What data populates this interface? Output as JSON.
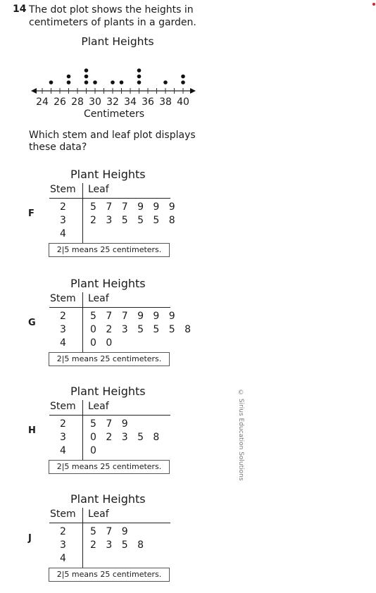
{
  "question": {
    "number": "14",
    "text": "The dot plot shows the heights in centimeters of plants in a garden.",
    "prompt": "Which stem and leaf plot displays these data?"
  },
  "chart_data": {
    "type": "scatter",
    "subtype": "dot-plot",
    "title": "Plant Heights",
    "xlabel": "Centimeters",
    "ylabel": "",
    "xlim": [
      24,
      40
    ],
    "tick_step": 1,
    "tick_labels": [
      "24",
      "26",
      "28",
      "30",
      "32",
      "34",
      "36",
      "38",
      "40"
    ],
    "points": [
      {
        "x": 25,
        "count": 1
      },
      {
        "x": 27,
        "count": 2
      },
      {
        "x": 29,
        "count": 3
      },
      {
        "x": 30,
        "count": 1
      },
      {
        "x": 32,
        "count": 1
      },
      {
        "x": 33,
        "count": 1
      },
      {
        "x": 35,
        "count": 3
      },
      {
        "x": 38,
        "count": 1
      },
      {
        "x": 40,
        "count": 2
      }
    ],
    "grid": false,
    "arrows": "both-ends"
  },
  "options": [
    {
      "letter": "F",
      "title": "Plant Heights",
      "stem_header": "Stem",
      "leaf_header": "Leaf",
      "rows": [
        {
          "stem": "2",
          "leaves": "5 7 7 9 9 9"
        },
        {
          "stem": "3",
          "leaves": "2 3 5 5 5 8"
        },
        {
          "stem": "4",
          "leaves": ""
        }
      ],
      "key": "2|5 means 25 centimeters."
    },
    {
      "letter": "G",
      "title": "Plant Heights",
      "stem_header": "Stem",
      "leaf_header": "Leaf",
      "rows": [
        {
          "stem": "2",
          "leaves": "5 7 7 9 9 9"
        },
        {
          "stem": "3",
          "leaves": "0 2 3 5 5 5 8"
        },
        {
          "stem": "4",
          "leaves": "0 0"
        }
      ],
      "key": "2|5 means 25 centimeters."
    },
    {
      "letter": "H",
      "title": "Plant Heights",
      "stem_header": "Stem",
      "leaf_header": "Leaf",
      "rows": [
        {
          "stem": "2",
          "leaves": "5 7 9"
        },
        {
          "stem": "3",
          "leaves": "0 2 3 5 8"
        },
        {
          "stem": "4",
          "leaves": "0"
        }
      ],
      "key": "2|5 means 25 centimeters."
    },
    {
      "letter": "J",
      "title": "Plant Heights",
      "stem_header": "Stem",
      "leaf_header": "Leaf",
      "rows": [
        {
          "stem": "2",
          "leaves": "5 7 9"
        },
        {
          "stem": "3",
          "leaves": "2 3 5 8"
        },
        {
          "stem": "4",
          "leaves": ""
        }
      ],
      "key": "2|5 means 25 centimeters."
    }
  ],
  "copyright": "© Sirius Education Solutions",
  "colors": {
    "marker": "#e02020",
    "ink": "#1a1a1a"
  }
}
